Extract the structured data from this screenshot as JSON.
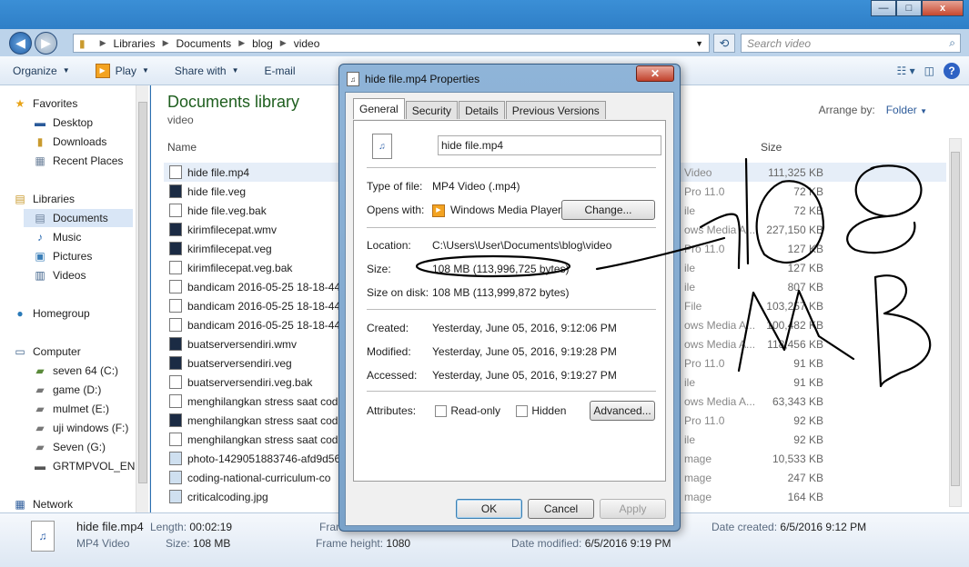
{
  "window": {
    "minimize": "—",
    "maximize": "□",
    "close": "x"
  },
  "address": {
    "crumbs": [
      "Libraries",
      "Documents",
      "blog",
      "video"
    ],
    "search_placeholder": "Search video"
  },
  "toolbar": {
    "organize": "Organize",
    "play": "Play",
    "share": "Share with",
    "email": "E-mail"
  },
  "nav": {
    "favorites": "Favorites",
    "desktop": "Desktop",
    "downloads": "Downloads",
    "recent": "Recent Places",
    "libraries": "Libraries",
    "documents": "Documents",
    "music": "Music",
    "pictures": "Pictures",
    "videos": "Videos",
    "homegroup": "Homegroup",
    "computer": "Computer",
    "drives": [
      "seven 64 (C:)",
      "game (D:)",
      "mulmet (E:)",
      "uji windows (F:)",
      "Seven (G:)",
      "GRTMPVOL_EN ("
    ],
    "network": "Network"
  },
  "library": {
    "title": "Documents library",
    "subtitle": "video",
    "arrange_label": "Arrange by:",
    "arrange_value": "Folder"
  },
  "columns": {
    "name": "Name",
    "size": "Size"
  },
  "files": [
    {
      "name": "hide file.mp4",
      "type": "Video",
      "size": "111,325 KB"
    },
    {
      "name": "hide file.veg",
      "type": "Pro 11.0",
      "size": "72 KB"
    },
    {
      "name": "hide file.veg.bak",
      "type": "ile",
      "size": "72 KB"
    },
    {
      "name": "kirimfilecepat.wmv",
      "type": "ows Media A...",
      "size": "227,150 KB"
    },
    {
      "name": "kirimfilecepat.veg",
      "type": "Pro 11.0",
      "size": "127 KB"
    },
    {
      "name": "kirimfilecepat.veg.bak",
      "type": "ile",
      "size": "127 KB"
    },
    {
      "name": "bandicam 2016-05-25 18-18-44-",
      "type": "ile",
      "size": "807 KB"
    },
    {
      "name": "bandicam 2016-05-25 18-18-44-",
      "type": "File",
      "size": "103,257 KB"
    },
    {
      "name": "bandicam 2016-05-25 18-18-44-",
      "type": "ows Media A...",
      "size": "100,482 KB"
    },
    {
      "name": "buatserversendiri.wmv",
      "type": "ows Media A...",
      "size": "118,456 KB"
    },
    {
      "name": "buatserversendiri.veg",
      "type": "Pro 11.0",
      "size": "91 KB"
    },
    {
      "name": "buatserversendiri.veg.bak",
      "type": "ile",
      "size": "91 KB"
    },
    {
      "name": "menghilangkan stress saat codi",
      "type": "ows Media A...",
      "size": "63,343 KB"
    },
    {
      "name": "menghilangkan stress saat codi",
      "type": "Pro 11.0",
      "size": "92 KB"
    },
    {
      "name": "menghilangkan stress saat codi",
      "type": "ile",
      "size": "92 KB"
    },
    {
      "name": "photo-1429051883746-afd9d56f",
      "type": "mage",
      "size": "10,533 KB"
    },
    {
      "name": "coding-national-curriculum-co",
      "type": "mage",
      "size": "247 KB"
    },
    {
      "name": "criticalcoding.jpg",
      "type": "mage",
      "size": "164 KB"
    }
  ],
  "details": {
    "filename": "hide file.mp4",
    "filetype": "MP4 Video",
    "length_label": "Length:",
    "length": "00:02:19",
    "size_label": "Size:",
    "size": "108 MB",
    "frame_label_cut": "Fran",
    "frame_height_label": "Frame height:",
    "frame_height": "1080",
    "created_label": "Date created:",
    "created": "6/5/2016 9:12 PM",
    "modified_label": "Date modified:",
    "modified": "6/5/2016 9:19 PM"
  },
  "dialog": {
    "title": "hide file.mp4 Properties",
    "tabs": [
      "General",
      "Security",
      "Details",
      "Previous Versions"
    ],
    "filename": "hide file.mp4",
    "type_label": "Type of file:",
    "type_value": "MP4 Video (.mp4)",
    "opens_label": "Opens with:",
    "opens_value": "Windows Media Player",
    "change_btn": "Change...",
    "location_label": "Location:",
    "location_value": "C:\\Users\\User\\Documents\\blog\\video",
    "size_label": "Size:",
    "size_value": "108 MB (113,996,725 bytes)",
    "sod_label": "Size on disk:",
    "sod_value": "108 MB (113,999,872 bytes)",
    "created_label": "Created:",
    "created_value": "Yesterday, June 05, 2016, 9:12:06 PM",
    "modified_label": "Modified:",
    "modified_value": "Yesterday, June 05, 2016, 9:19:28 PM",
    "accessed_label": "Accessed:",
    "accessed_value": "Yesterday, June 05, 2016, 9:19:27 PM",
    "attr_label": "Attributes:",
    "readonly": "Read-only",
    "hidden": "Hidden",
    "advanced_btn": "Advanced...",
    "ok": "OK",
    "cancel": "Cancel",
    "apply": "Apply"
  },
  "annotation": {
    "text": "108 MB",
    "color": "#000000"
  }
}
